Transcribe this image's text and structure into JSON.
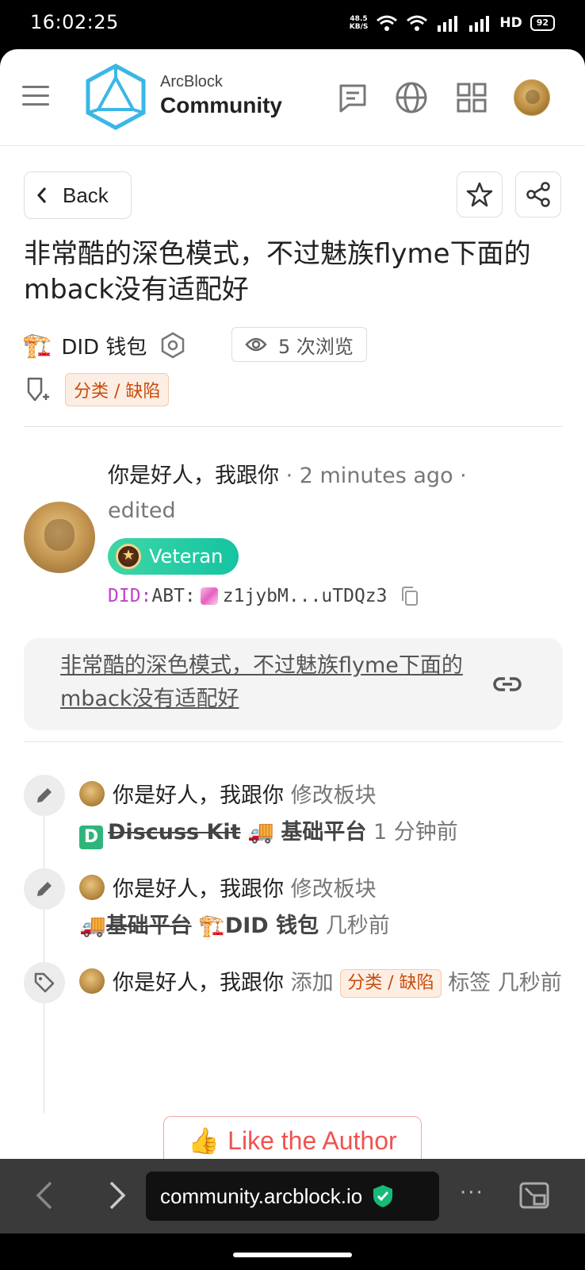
{
  "status_bar": {
    "time": "16:02:25",
    "net_speed_value": "48.5",
    "net_speed_unit": "KB/S",
    "hd_label": "HD",
    "battery": "92"
  },
  "header": {
    "logo_line1": "ArcBlock",
    "logo_line2": "Community"
  },
  "toolbar": {
    "back_label": "Back"
  },
  "post": {
    "title": "非常酷的深色模式，不过魅族flyme下面的mback没有适配好",
    "board_emoji": "🏗️",
    "board_name": "DID 钱包",
    "views": "5 次浏览",
    "tag": "分类 / 缺陷"
  },
  "author": {
    "name": "你是好人，我跟你",
    "time": "2 minutes ago",
    "edited": "edited",
    "badge": "Veteran",
    "did_prefix": "DID:",
    "did_type": "ABT:",
    "did_value": "z1jybM...uTDQz3"
  },
  "content": {
    "link_text": "非常酷的深色模式，不过魅族flyme下面的mback没有适配好"
  },
  "timeline": [
    {
      "icon": "pencil-icon",
      "user": "你是好人，我跟你",
      "action": "修改板块",
      "from_badge": "D",
      "from": "Discuss Kit",
      "to_emoji": "🚚",
      "to": "基础平台",
      "time": "1 分钟前"
    },
    {
      "icon": "pencil-icon",
      "user": "你是好人，我跟你",
      "action": "修改板块",
      "from_emoji": "🚚",
      "from": "基础平台",
      "to_emoji": "🏗️",
      "to": "DID 钱包",
      "time": "几秒前"
    },
    {
      "icon": "tag-icon",
      "user": "你是好人，我跟你",
      "action": "添加",
      "tag": "分类 / 缺陷",
      "suffix": "标签",
      "time": "几秒前"
    }
  ],
  "like": {
    "label": "Like the Author",
    "emoji": "👍"
  },
  "browser": {
    "url": "community.arcblock.io",
    "menu": "···"
  },
  "colors": {
    "accent_green": "#14c4a1",
    "tag_orange": "#c84c0c",
    "like_red": "#ef5350",
    "did_pink": "#c043c8"
  }
}
